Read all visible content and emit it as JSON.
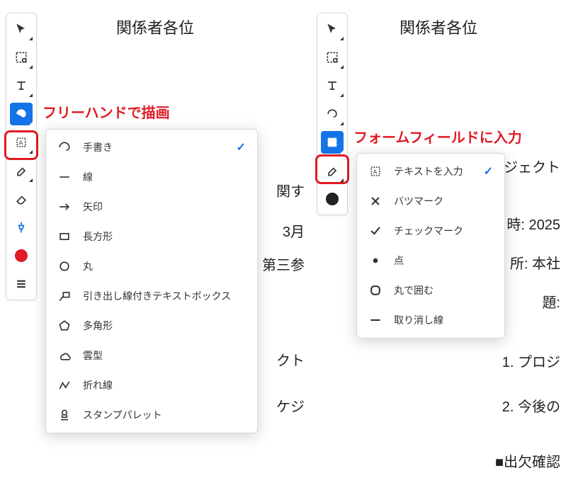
{
  "left": {
    "title": "関係者各位",
    "label": "フリーハンドで描画",
    "menu": {
      "items": [
        {
          "icon": "freehand",
          "label": "手書き",
          "selected": true
        },
        {
          "icon": "line",
          "label": "線"
        },
        {
          "icon": "arrow",
          "label": "矢印"
        },
        {
          "icon": "rect",
          "label": "長方形"
        },
        {
          "icon": "circle",
          "label": "丸"
        },
        {
          "icon": "callout",
          "label": "引き出し線付きテキストボックス"
        },
        {
          "icon": "polygon",
          "label": "多角形"
        },
        {
          "icon": "cloud",
          "label": "雲型"
        },
        {
          "icon": "polyline",
          "label": "折れ線"
        },
        {
          "icon": "stamp",
          "label": "スタンプパレット"
        }
      ]
    },
    "doc_lines": {
      "l1": "関す",
      "l2": "3月",
      "l3": "第三参",
      "l4": "クト",
      "l5": "ケジ"
    }
  },
  "right": {
    "title": "関係者各位",
    "label": "フォームフィールドに入力",
    "menu": {
      "items": [
        {
          "icon": "text-fill",
          "label": "テキストを入力",
          "selected": true
        },
        {
          "icon": "x-mark",
          "label": "バツマーク"
        },
        {
          "icon": "check-mark",
          "label": "チェックマーク"
        },
        {
          "icon": "dot",
          "label": "点"
        },
        {
          "icon": "circle-around",
          "label": "丸で囲む"
        },
        {
          "icon": "strikethrough",
          "label": "取り消し線"
        }
      ]
    },
    "doc_lines": {
      "l1": "ジェクト",
      "l2": "時: 2025",
      "l3": "所: 本社",
      "l4": "題:",
      "l5": "1.  プロジ",
      "l6": "2.  今後の",
      "l7": "■出欠確認"
    }
  },
  "colors": {
    "accent": "#1473e6",
    "highlight": "#e01b24",
    "left_dot": "#e01b24",
    "right_dot": "#222"
  }
}
